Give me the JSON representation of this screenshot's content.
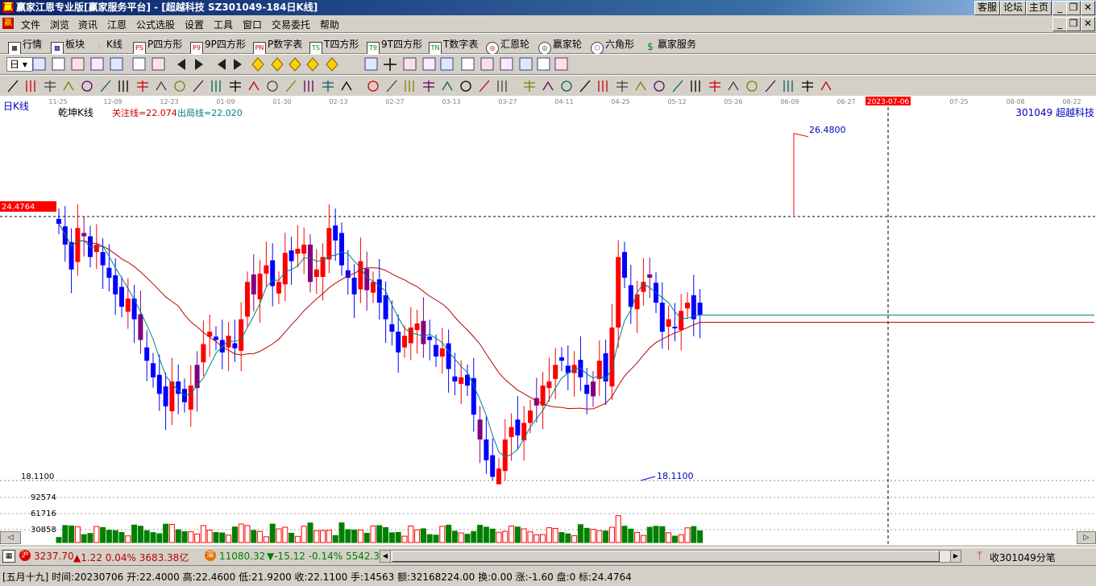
{
  "title": {
    "logo": "赢",
    "text": "赢家江恩专业版[赢家服务平台] - [超越科技   SZ301049-184日K线]",
    "buttons": [
      "客服",
      "论坛",
      "主页"
    ]
  },
  "menu": [
    "文件",
    "浏览",
    "资讯",
    "江恩",
    "公式选股",
    "设置",
    "工具",
    "窗口",
    "交易委托",
    "帮助"
  ],
  "toolbar1": [
    "行情",
    "板块",
    "K线",
    "P四方形",
    "9P四方形",
    "P数字表",
    "T四方形",
    "9T四方形",
    "T数字表",
    "汇恩轮",
    "赢家轮",
    "六角形",
    "赢家服务"
  ],
  "toolbar1_badges": [
    "",
    "",
    "",
    "PS",
    "P9",
    "PN",
    "TS",
    "T9",
    "TN",
    "",
    "",
    "",
    "$"
  ],
  "toolbar2_dropdown": "日",
  "chart": {
    "period_label": "日K线",
    "indicator_name": "乾坤K线",
    "focus_line": "关注线=22.074",
    "exit_line": "出局线=22.020",
    "stock": "301049  超越科技",
    "left_price_label": "24.4764",
    "y_low_label": "18.1100",
    "high_annotation": "26.4800",
    "low_annotation": "18.1100",
    "vol_labels": [
      "92574",
      "61716",
      "30858"
    ],
    "dates": [
      "11-25",
      "12-09",
      "12-23",
      "01-09",
      "01-30",
      "02-13",
      "02-27",
      "03-13",
      "03-27",
      "04-11",
      "04-25",
      "05-12",
      "05-26",
      "06-09",
      "06-27",
      "2023-07-06",
      "07-25",
      "08-08",
      "08-22"
    ],
    "colors": {
      "up": "#ff0000",
      "down": "#0000ff",
      "neutral": "#800080",
      "ma_fast": "#008080",
      "ma_slow": "#c00000",
      "volume": "#008000"
    }
  },
  "chart_data": {
    "type": "candlestick",
    "high_marker": 26.48,
    "low_marker": 18.11,
    "reference_price": 24.4764,
    "closes": [
      24.3,
      23.8,
      23.2,
      24.2,
      24.0,
      23.5,
      23.8,
      23.3,
      23.0,
      22.6,
      22.3,
      22.5,
      22.0,
      21.5,
      21.0,
      20.6,
      20.2,
      19.9,
      20.5,
      20.2,
      20.0,
      20.4,
      20.9,
      21.4,
      21.7,
      21.5,
      21.2,
      21.6,
      21.3,
      22.0,
      22.9,
      22.6,
      23.1,
      23.3,
      22.8,
      22.9,
      23.6,
      23.4,
      23.7,
      23.8,
      22.9,
      23.2,
      23.5,
      24.2,
      23.9,
      23.3,
      23.0,
      22.6,
      23.4,
      22.7,
      22.9,
      22.4,
      22.0,
      21.7,
      21.2,
      21.6,
      21.8,
      21.9,
      21.4,
      21.5,
      21.1,
      21.3,
      20.8,
      20.5,
      20.6,
      20.4,
      19.7,
      19.1,
      18.6,
      18.2,
      18.4,
      19.1,
      19.4,
      19.2,
      19.5,
      19.8,
      20.1,
      20.4,
      20.5,
      20.9,
      21.0,
      20.7,
      20.9,
      20.6,
      20.2,
      20.5,
      21.0,
      20.5,
      21.8,
      23.5,
      23.0,
      22.3,
      22.6,
      22.9,
      23.0,
      22.4,
      21.7,
      22.0,
      21.8,
      22.2,
      22.4,
      22.0,
      22.11
    ],
    "volume_scale": [
      30858,
      61716,
      92574
    ]
  },
  "status": {
    "sh_badge": "沪",
    "sh_index": "3237.70",
    "sh_change": "▲1.22 0.04% 3683.38亿",
    "sz_badge": "深",
    "sz_index": "11080.32",
    "sz_change": "▼-15.12 -0.14% 5542.3",
    "right_text": "收301049分笔"
  },
  "info": "[五月十九] 时间:20230706 开:22.4000 高:22.4600 低:21.9200 收:22.1100 手:14563 额:32168224.00 换:0.00 涨:-1.60 盘:0 标:24.4764"
}
